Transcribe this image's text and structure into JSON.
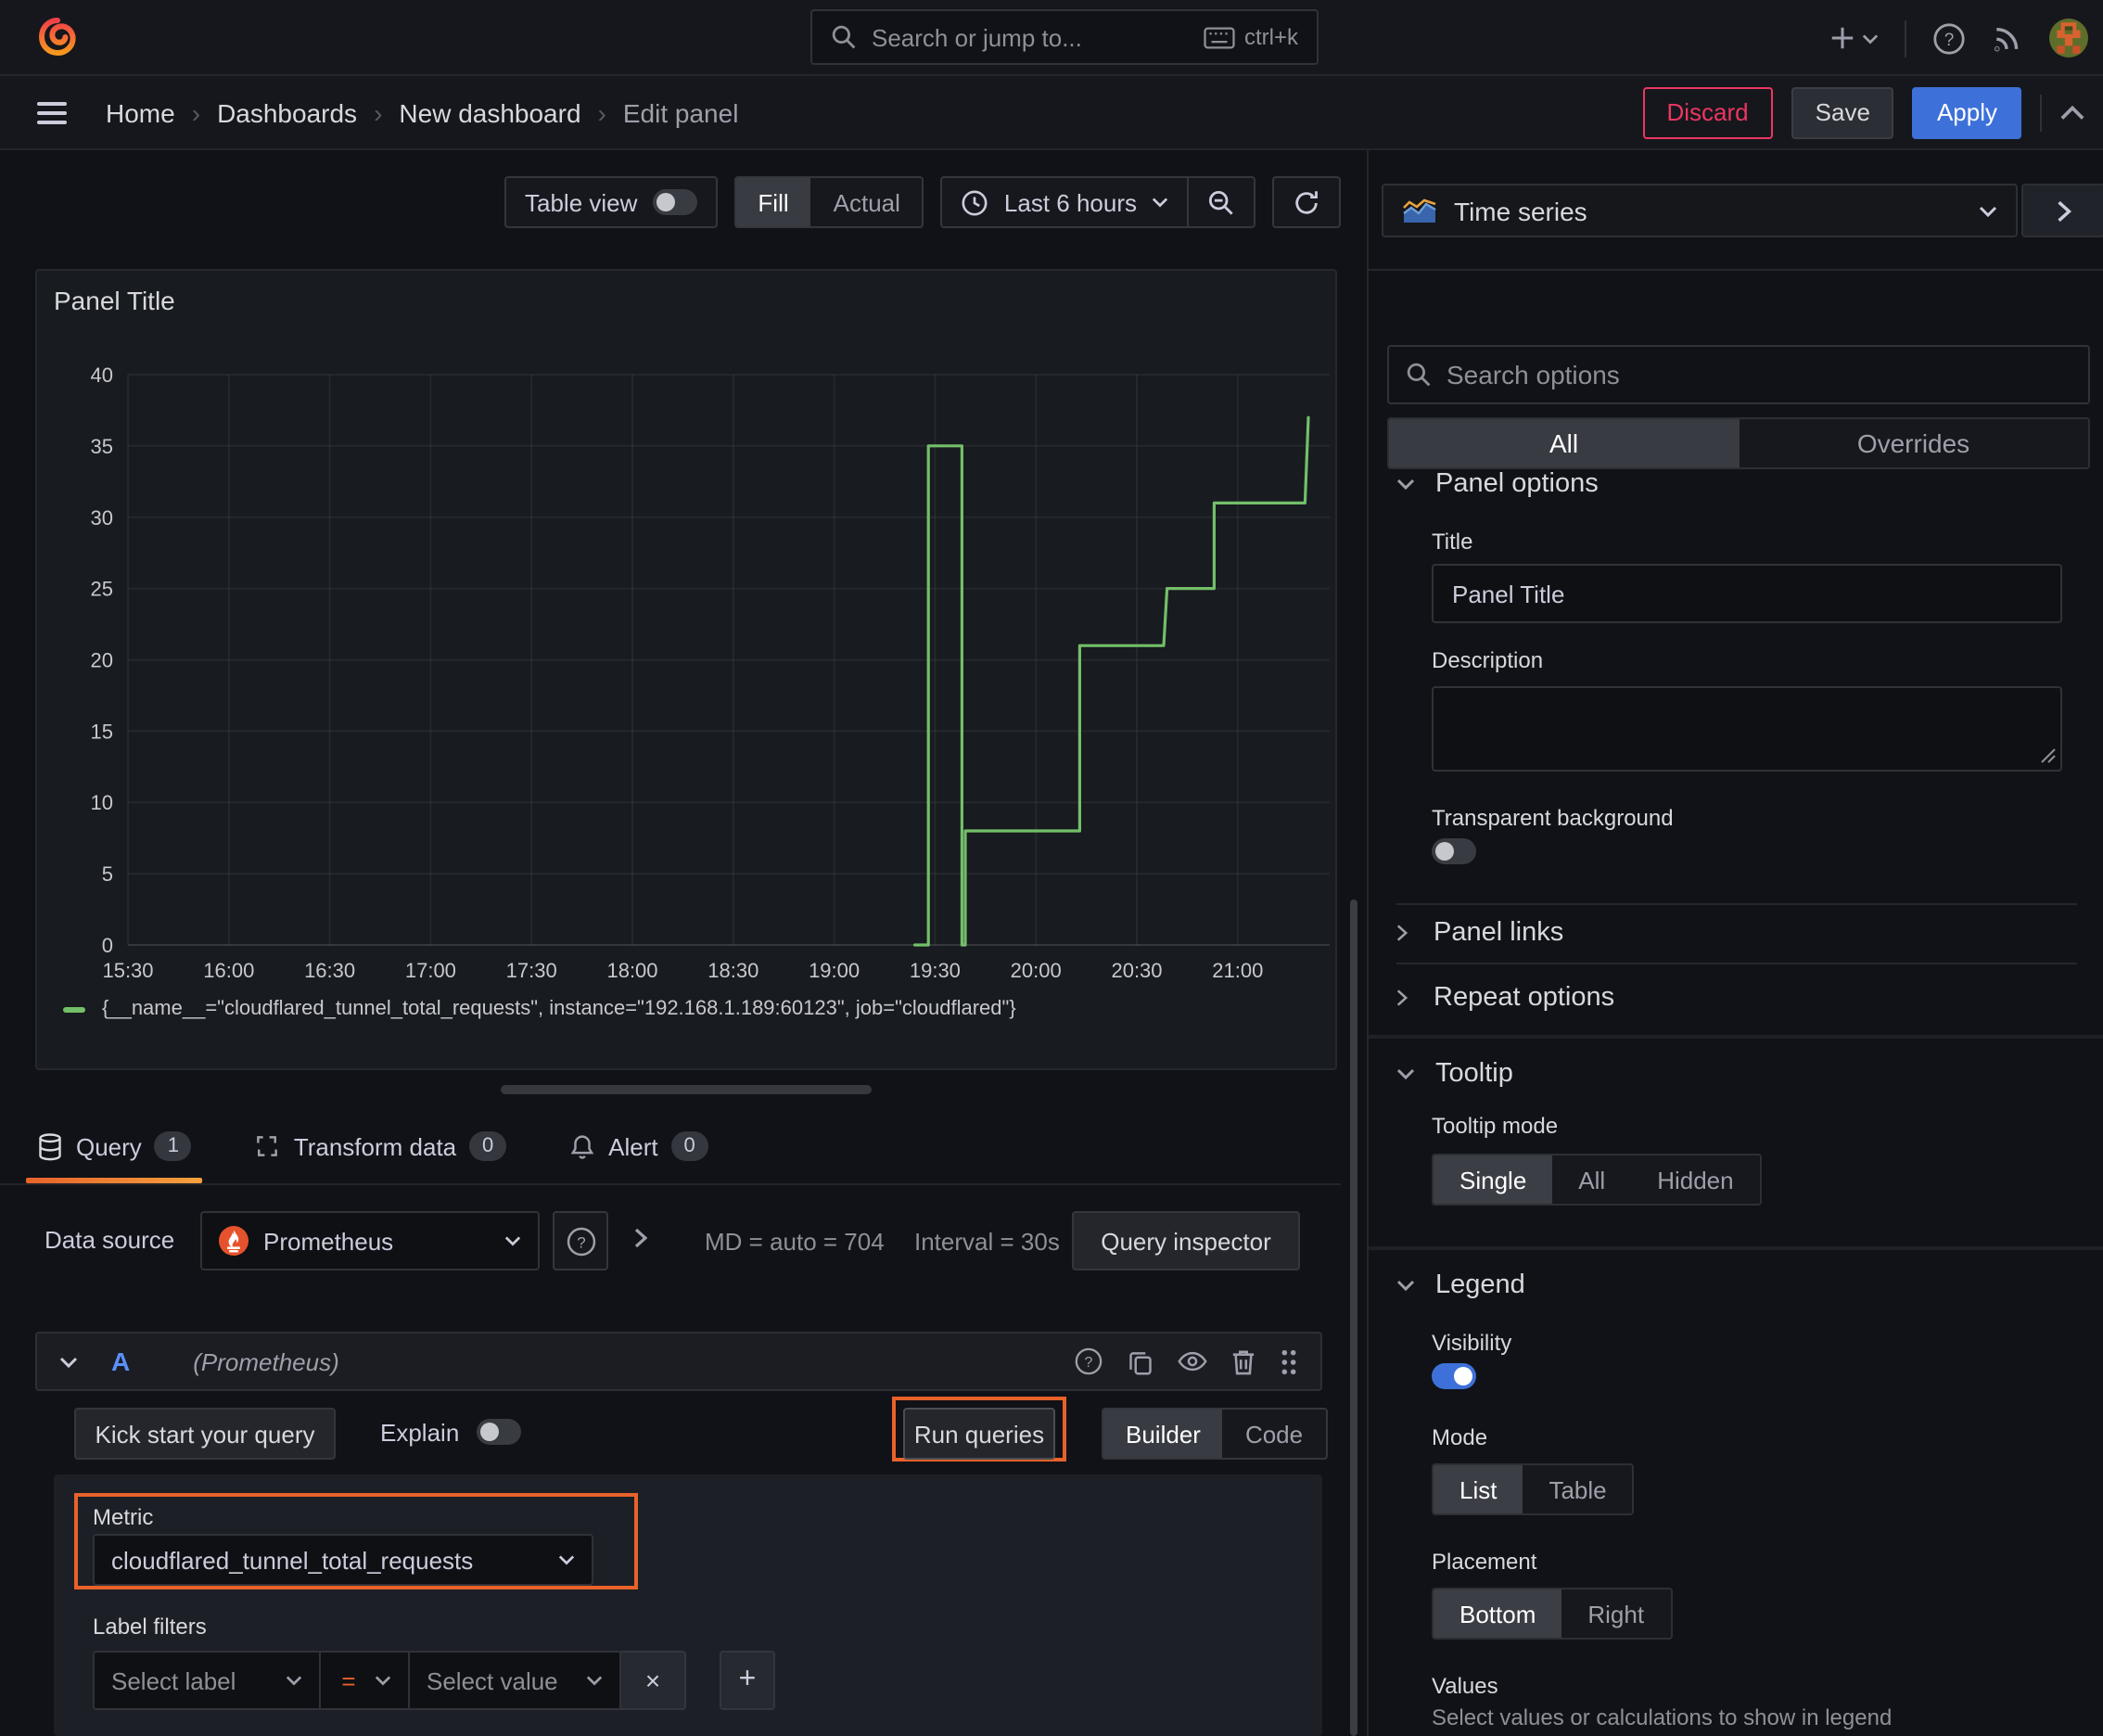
{
  "topbar": {
    "search_placeholder": "Search or jump to...",
    "search_shortcut": "ctrl+k"
  },
  "breadcrumb": {
    "items": [
      "Home",
      "Dashboards",
      "New dashboard",
      "Edit panel"
    ],
    "separator": "›"
  },
  "actions": {
    "discard": "Discard",
    "save": "Save",
    "apply": "Apply"
  },
  "toolbar": {
    "table_view": "Table view",
    "fill": "Fill",
    "actual": "Actual",
    "time_range": "Last 6 hours"
  },
  "panel": {
    "title": "Panel Title",
    "legend": "{__name__=\"cloudflared_tunnel_total_requests\", instance=\"192.168.1.189:60123\", job=\"cloudflared\"}"
  },
  "chart_data": {
    "type": "line",
    "line_style": "step",
    "title": "Panel Title",
    "xlabel": "",
    "ylabel": "",
    "x_ticks": [
      "15:30",
      "16:00",
      "16:30",
      "17:00",
      "17:30",
      "18:00",
      "18:30",
      "19:00",
      "19:30",
      "20:00",
      "20:30",
      "21:00"
    ],
    "x_axis_start": "15:30",
    "minutes_per_tick": 30,
    "y_ticks": [
      40,
      35,
      30,
      25,
      20,
      15,
      10,
      5,
      0
    ],
    "ylim": [
      0,
      40
    ],
    "grid": true,
    "legend_position": "bottom",
    "series": [
      {
        "name": "{__name__=\"cloudflared_tunnel_total_requests\", instance=\"192.168.1.189:60123\", job=\"cloudflared\"}",
        "color": "#73bf69",
        "points": [
          [
            "19:24",
            0
          ],
          [
            "19:28",
            0
          ],
          [
            "19:28",
            35
          ],
          [
            "19:38",
            35
          ],
          [
            "19:38",
            0
          ],
          [
            "19:39",
            0
          ],
          [
            "19:39",
            8
          ],
          [
            "20:13",
            8
          ],
          [
            "20:13",
            21
          ],
          [
            "20:38",
            21
          ],
          [
            "20:39",
            25
          ],
          [
            "20:53",
            25
          ],
          [
            "20:53",
            31
          ],
          [
            "21:20",
            31
          ],
          [
            "21:21",
            37
          ]
        ]
      }
    ]
  },
  "tabs": {
    "query": {
      "label": "Query",
      "count": "1"
    },
    "transform": {
      "label": "Transform data",
      "count": "0"
    },
    "alert": {
      "label": "Alert",
      "count": "0"
    }
  },
  "query": {
    "datasource_label": "Data source",
    "datasource": "Prometheus",
    "stats_md": "MD = auto = 704",
    "stats_interval": "Interval = 30s",
    "inspector": "Query inspector",
    "ref_id": "A",
    "ref_note": "(Prometheus)",
    "kick_start": "Kick start your query",
    "explain": "Explain",
    "run": "Run queries",
    "builder": "Builder",
    "code": "Code",
    "metric_label": "Metric",
    "metric_value": "cloudflared_tunnel_total_requests",
    "label_filters_label": "Label filters",
    "select_label": "Select label",
    "operator": "=",
    "select_value": "Select value"
  },
  "sidebar": {
    "visualization": "Time series",
    "search_placeholder": "Search options",
    "tabs": {
      "all": "All",
      "overrides": "Overrides"
    },
    "panel_options": {
      "title": "Panel options",
      "title_label": "Title",
      "title_value": "Panel Title",
      "description_label": "Description",
      "transparent_label": "Transparent background"
    },
    "collapsed": {
      "panel_links": "Panel links",
      "repeat_options": "Repeat options"
    },
    "tooltip": {
      "title": "Tooltip",
      "mode_label": "Tooltip mode",
      "options": [
        "Single",
        "All",
        "Hidden"
      ],
      "selected": "Single"
    },
    "legend": {
      "title": "Legend",
      "visibility_label": "Visibility",
      "mode_label": "Mode",
      "mode_options": [
        "List",
        "Table"
      ],
      "mode_selected": "List",
      "placement_label": "Placement",
      "placement_options": [
        "Bottom",
        "Right"
      ],
      "placement_selected": "Bottom",
      "values_label": "Values",
      "values_help": "Select values or calculations to show in legend"
    }
  },
  "colors": {
    "accent_blue": "#3d71d9",
    "series_green": "#73bf69",
    "annotation_orange": "#e8622a",
    "danger_pink": "#eb3661"
  }
}
